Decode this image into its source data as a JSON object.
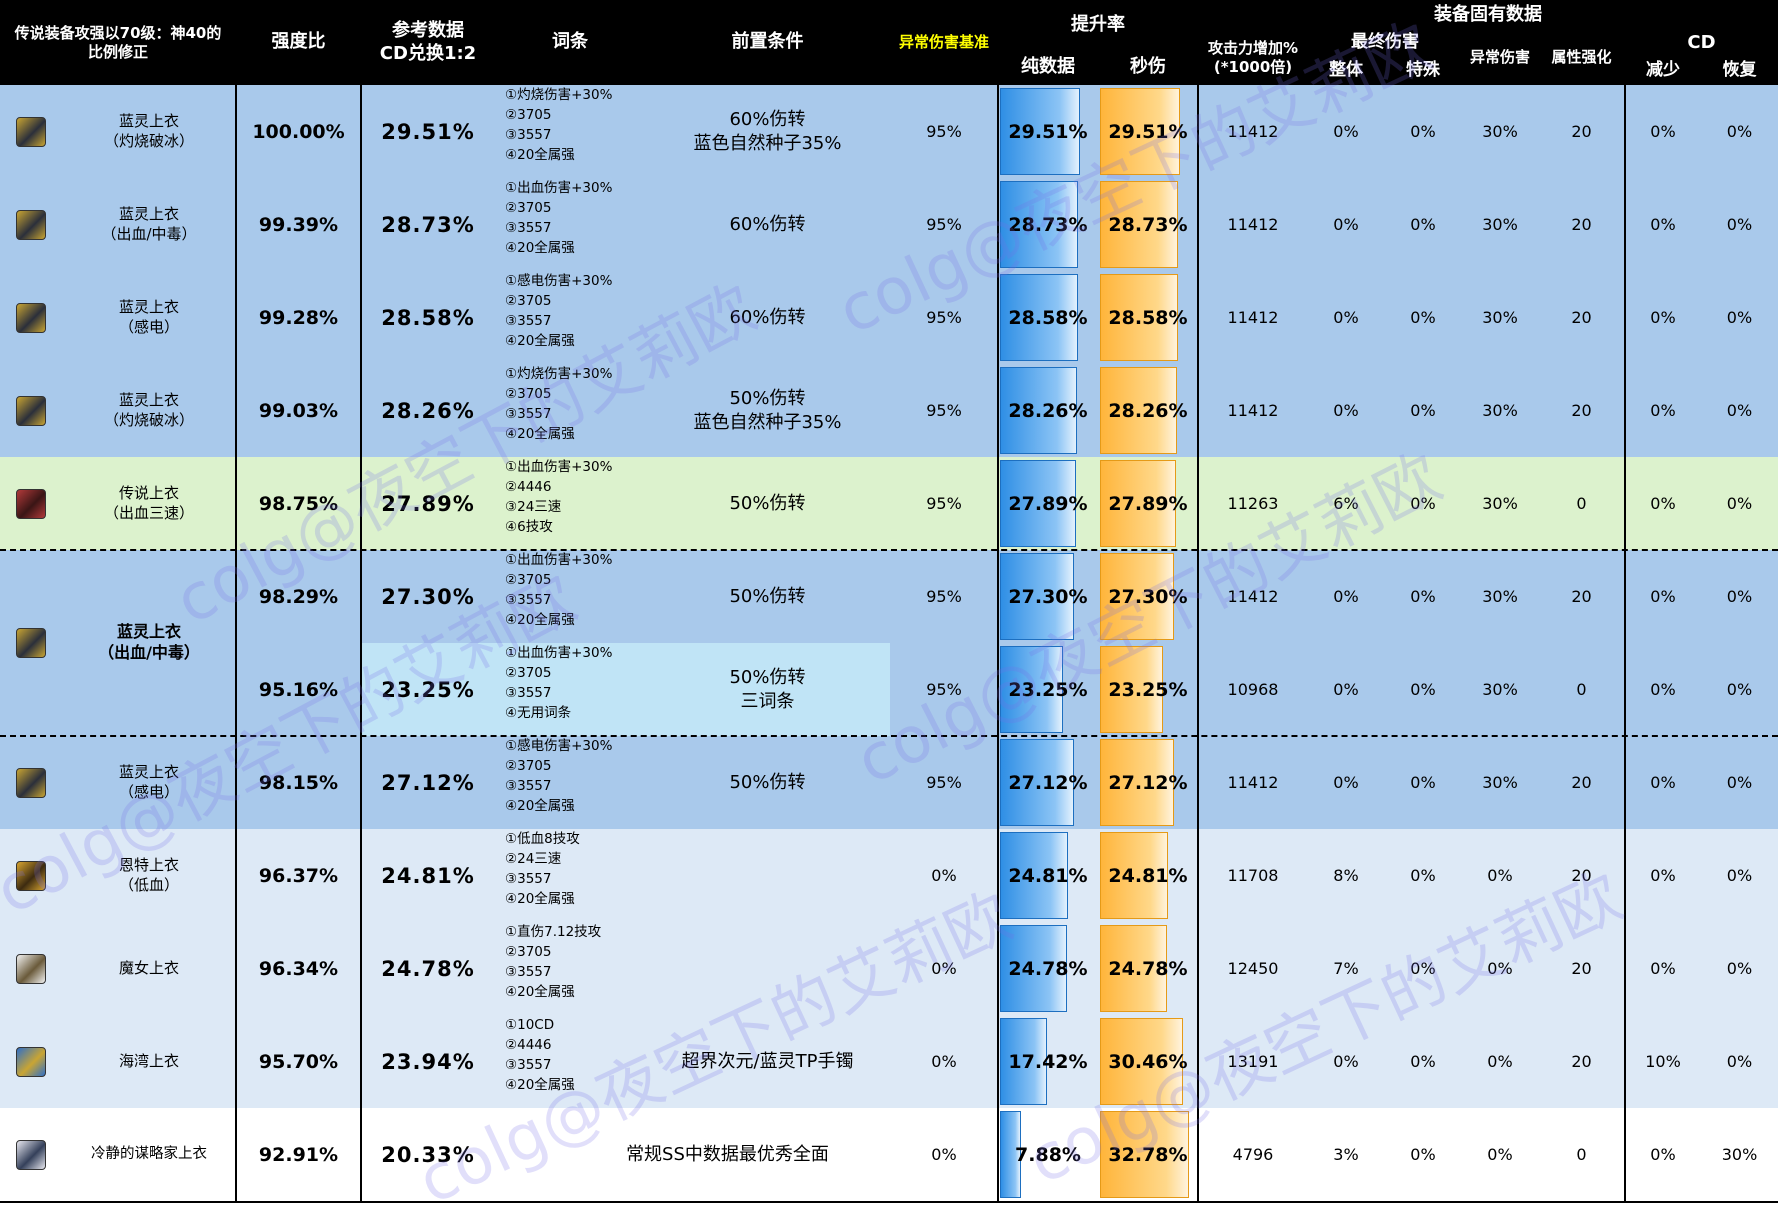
{
  "header": {
    "title": "传说装备攻强以70级：神40的\n比例修正",
    "ratio": "强度比",
    "ref": "参考数据\nCD兑换1:2",
    "affix": "词条",
    "precond": "前置条件",
    "abnormal_base": "异常伤害基准",
    "boost": "提升率",
    "boost_pure": "纯数据",
    "boost_sec": "秒伤",
    "fixed": "装备固有数据",
    "atk": "攻击力增加%\n(*1000倍)",
    "final_dmg": "最终伤害",
    "final_whole": "整体",
    "final_special": "特殊",
    "abn_dmg": "异常伤害",
    "elem": "属性强化",
    "cd": "CD",
    "cd_reduce": "减少",
    "cd_recover": "恢复"
  },
  "colors": {
    "header_bg": "#000000",
    "blue_row": "#a9c9eb",
    "green_row": "#dcf2cd",
    "light_row": "#dde9f6",
    "light_cyan": "#c0e4f6",
    "white_row": "#ffffff",
    "abnormal_header": "#ffff00",
    "bar_blue": "#2f8fe5",
    "bar_orange": "#ffb53b"
  },
  "rows": [
    {
      "name": "蓝灵上衣\n（灼烧破冰）",
      "icon": "lanling-icon",
      "ratio": "100.00%",
      "ref": "29.51%",
      "affix": [
        "①灼烧伤害+30%",
        "②3705",
        "③3557",
        "④20全属强"
      ],
      "cond": "60%伤转\n蓝色自然种子35%",
      "abn": "95%",
      "pure": "29.51%",
      "pure_v": 29.51,
      "sec": "29.51%",
      "sec_v": 29.51,
      "atk": "11412",
      "whole": "0%",
      "special": "0%",
      "abn_dmg": "30%",
      "elem": "20",
      "cd_red": "0%",
      "cd_rec": "0%",
      "bg": "blue"
    },
    {
      "name": "蓝灵上衣\n（出血/中毒）",
      "icon": "lanling-icon",
      "ratio": "99.39%",
      "ref": "28.73%",
      "affix": [
        "①出血伤害+30%",
        "②3705",
        "③3557",
        "④20全属强"
      ],
      "cond": "60%伤转",
      "abn": "95%",
      "pure": "28.73%",
      "pure_v": 28.73,
      "sec": "28.73%",
      "sec_v": 28.73,
      "atk": "11412",
      "whole": "0%",
      "special": "0%",
      "abn_dmg": "30%",
      "elem": "20",
      "cd_red": "0%",
      "cd_rec": "0%",
      "bg": "blue"
    },
    {
      "name": "蓝灵上衣\n（感电）",
      "icon": "lanling-icon",
      "ratio": "99.28%",
      "ref": "28.58%",
      "affix": [
        "①感电伤害+30%",
        "②3705",
        "③3557",
        "④20全属强"
      ],
      "cond": "60%伤转",
      "abn": "95%",
      "pure": "28.58%",
      "pure_v": 28.58,
      "sec": "28.58%",
      "sec_v": 28.58,
      "atk": "11412",
      "whole": "0%",
      "special": "0%",
      "abn_dmg": "30%",
      "elem": "20",
      "cd_red": "0%",
      "cd_rec": "0%",
      "bg": "blue"
    },
    {
      "name": "蓝灵上衣\n（灼烧破冰）",
      "icon": "lanling-icon",
      "ratio": "99.03%",
      "ref": "28.26%",
      "affix": [
        "①灼烧伤害+30%",
        "②3705",
        "③3557",
        "④20全属强"
      ],
      "cond": "50%伤转\n蓝色自然种子35%",
      "abn": "95%",
      "pure": "28.26%",
      "pure_v": 28.26,
      "sec": "28.26%",
      "sec_v": 28.26,
      "atk": "11412",
      "whole": "0%",
      "special": "0%",
      "abn_dmg": "30%",
      "elem": "20",
      "cd_red": "0%",
      "cd_rec": "0%",
      "bg": "blue"
    },
    {
      "name": "传说上衣\n（出血三速）",
      "icon": "legend-icon",
      "ratio": "98.75%",
      "ref": "27.89%",
      "affix": [
        "①出血伤害+30%",
        "②4446",
        "③24三速",
        "④6技攻"
      ],
      "cond": "50%伤转",
      "abn": "95%",
      "pure": "27.89%",
      "pure_v": 27.89,
      "sec": "27.89%",
      "sec_v": 27.89,
      "atk": "11263",
      "whole": "6%",
      "special": "0%",
      "abn_dmg": "30%",
      "elem": "0",
      "cd_red": "0%",
      "cd_rec": "0%",
      "bg": "green"
    },
    {
      "name": "",
      "icon": "",
      "ratio": "98.29%",
      "ref": "27.30%",
      "affix": [
        "①出血伤害+30%",
        "②3705",
        "③3557",
        "④20全属强"
      ],
      "cond": "50%伤转",
      "abn": "95%",
      "pure": "27.30%",
      "pure_v": 27.3,
      "sec": "27.30%",
      "sec_v": 27.3,
      "atk": "11412",
      "whole": "0%",
      "special": "0%",
      "abn_dmg": "30%",
      "elem": "20",
      "cd_red": "0%",
      "cd_rec": "0%",
      "bg": "blue"
    },
    {
      "name": "",
      "icon": "",
      "ratio": "95.16%",
      "ref": "23.25%",
      "affix": [
        "①出血伤害+30%",
        "②3705",
        "③3557",
        "④无用词条"
      ],
      "cond": "50%伤转\n三词条",
      "abn": "95%",
      "pure": "23.25%",
      "pure_v": 23.25,
      "sec": "23.25%",
      "sec_v": 23.25,
      "atk": "10968",
      "whole": "0%",
      "special": "0%",
      "abn_dmg": "30%",
      "elem": "0",
      "cd_red": "0%",
      "cd_rec": "0%",
      "bg": "blue"
    },
    {
      "name": "蓝灵上衣\n（感电）",
      "icon": "lanling-icon",
      "ratio": "98.15%",
      "ref": "27.12%",
      "affix": [
        "①感电伤害+30%",
        "②3705",
        "③3557",
        "④20全属强"
      ],
      "cond": "50%伤转",
      "abn": "95%",
      "pure": "27.12%",
      "pure_v": 27.12,
      "sec": "27.12%",
      "sec_v": 27.12,
      "atk": "11412",
      "whole": "0%",
      "special": "0%",
      "abn_dmg": "30%",
      "elem": "20",
      "cd_red": "0%",
      "cd_rec": "0%",
      "bg": "blue"
    },
    {
      "name": "恩特上衣\n（低血）",
      "icon": "ent-icon",
      "ratio": "96.37%",
      "ref": "24.81%",
      "affix": [
        "①低血8技攻",
        "②24三速",
        "③3557",
        "④20全属强"
      ],
      "cond": "",
      "abn": "0%",
      "pure": "24.81%",
      "pure_v": 24.81,
      "sec": "24.81%",
      "sec_v": 24.81,
      "atk": "11708",
      "whole": "8%",
      "special": "0%",
      "abn_dmg": "0%",
      "elem": "20",
      "cd_red": "0%",
      "cd_rec": "0%",
      "bg": "light"
    },
    {
      "name": "魔女上衣",
      "icon": "witch-icon",
      "ratio": "96.34%",
      "ref": "24.78%",
      "affix": [
        "①直伤7.12技攻",
        "②3705",
        "③3557",
        "④20全属强"
      ],
      "cond": "",
      "abn": "0%",
      "pure": "24.78%",
      "pure_v": 24.78,
      "sec": "24.78%",
      "sec_v": 24.78,
      "atk": "12450",
      "whole": "7%",
      "special": "0%",
      "abn_dmg": "0%",
      "elem": "20",
      "cd_red": "0%",
      "cd_rec": "0%",
      "bg": "light"
    },
    {
      "name": "海湾上衣",
      "icon": "bay-icon",
      "ratio": "95.70%",
      "ref": "23.94%",
      "affix": [
        "①10CD",
        "②4446",
        "③3557",
        "④20全属强"
      ],
      "cond": "超界次元/蓝灵TP手镯",
      "abn": "0%",
      "pure": "17.42%",
      "pure_v": 17.42,
      "sec": "30.46%",
      "sec_v": 30.46,
      "atk": "13191",
      "whole": "0%",
      "special": "0%",
      "abn_dmg": "0%",
      "elem": "20",
      "cd_red": "10%",
      "cd_rec": "0%",
      "bg": "light"
    },
    {
      "name": "冷静的谋略家上衣",
      "icon": "strategist-icon",
      "ratio": "92.91%",
      "ref": "20.33%",
      "affix": [],
      "cond": "常规SS中数据最优秀全面",
      "abn": "0%",
      "pure": "7.88%",
      "pure_v": 7.88,
      "sec": "32.78%",
      "sec_v": 32.78,
      "atk": "4796",
      "whole": "3%",
      "special": "0%",
      "abn_dmg": "0%",
      "elem": "0",
      "cd_red": "0%",
      "cd_rec": "30%",
      "bg": "white"
    }
  ],
  "merged": {
    "name": "蓝灵上衣\n（出血/中毒）",
    "icon": "lanling-icon"
  },
  "bar_max": 36,
  "watermark": "colg@夜空下的艾莉欧"
}
